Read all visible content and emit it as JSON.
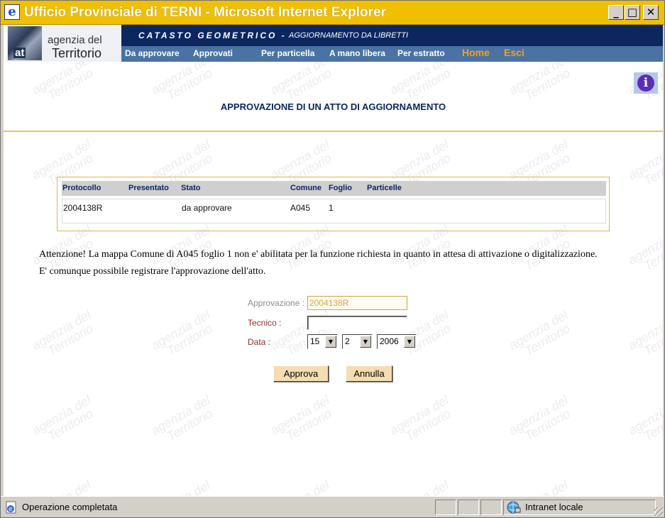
{
  "window": {
    "title": "Ufficio Provinciale di TERNI - Microsoft Internet Explorer",
    "min_glyph": "_",
    "max_glyph": "□",
    "close_glyph": "✕"
  },
  "logo": {
    "badge": "at",
    "line1": "agenzia del",
    "line2": "Territorio"
  },
  "banner": {
    "part1": "CATASTO GEOMETRICO -",
    "part2": "AGGIORNAMENTO DA LIBRETTI"
  },
  "menu": {
    "items": [
      "Da approvare",
      "Approvati",
      "Per particella",
      "A mano libera",
      "Per estratto",
      "Home",
      "Esci"
    ]
  },
  "page": {
    "heading": "APPROVAZIONE DI UN ATTO DI AGGIORNAMENTO",
    "watermark": "agenzia del\n   Territorio"
  },
  "table": {
    "headers": [
      "Protocollo",
      "Presentato",
      "Stato",
      "Comune",
      "Foglio",
      "Particelle"
    ],
    "rows": [
      [
        "2004138R",
        "",
        "da approvare",
        "A045",
        "1",
        ""
      ]
    ]
  },
  "warning": {
    "line1": "Attenzione! La mappa Comune di A045 foglio 1 non e' abilitata per la funzione richiesta in quanto in attesa di attivazione o digitalizzazione.",
    "line2": "E' comunque possibile registrare l'approvazione dell'atto."
  },
  "form": {
    "approvazione_label": "Approvazione :",
    "approvazione_value": "2004138R",
    "tecnico_label": "Tecnico :",
    "tecnico_value": "",
    "data_label": "Data :",
    "day": "15",
    "month": "2",
    "year": "2006",
    "approva_label": "Approva",
    "annulla_label": "Annulla"
  },
  "statusbar": {
    "status": "Operazione completata",
    "zone": "Intranet locale"
  },
  "colors": {
    "titlebar": "#f0c000",
    "banner": "#0c2660",
    "menu": "#4a72a2",
    "menu_highlight": "#f3a21f",
    "button": "#f5ddb0",
    "rule": "#e7c45c"
  }
}
